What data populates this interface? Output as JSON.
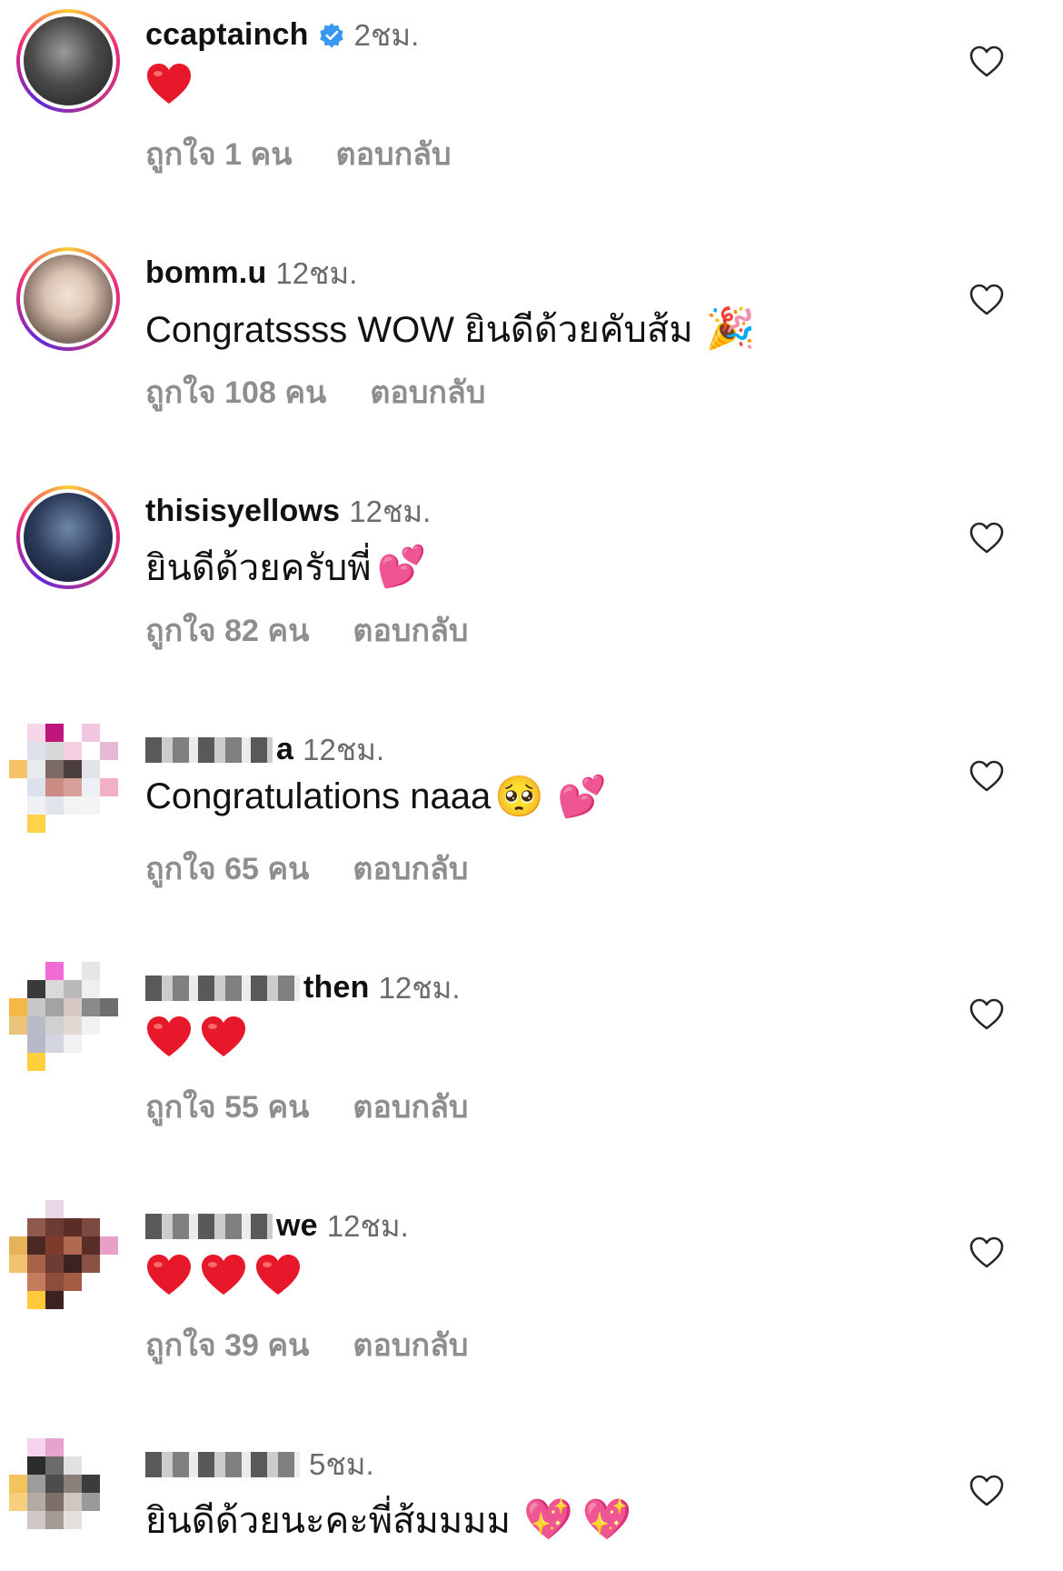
{
  "comments": [
    {
      "username": "ccaptainch",
      "verified": true,
      "time": "2ชม.",
      "text": "",
      "emoji": [
        "red-heart"
      ],
      "likes": "ถูกใจ 1 คน",
      "reply": "ตอบกลับ"
    },
    {
      "username": "bomm.u",
      "verified": false,
      "time": "12ชม.",
      "text": "Congratssss WOW ยินดีด้วยคับส้ม",
      "emoji": [
        "party-popper"
      ],
      "likes": "ถูกใจ 108 คน",
      "reply": "ตอบกลับ"
    },
    {
      "username": "thisisyellows",
      "verified": false,
      "time": "12ชม.",
      "text": "ยินดีด้วยครับพี่",
      "emoji": [
        "two-hearts"
      ],
      "likes": "ถูกใจ 82 คน",
      "reply": "ตอบกลับ"
    },
    {
      "username": "a",
      "verified": false,
      "time": "12ชม.",
      "text": "Congratulations naaa",
      "emoji": [
        "pleading-face",
        "two-hearts"
      ],
      "likes": "ถูกใจ 65 คน",
      "reply": "ตอบกลับ"
    },
    {
      "username": "then",
      "verified": false,
      "time": "12ชม.",
      "text": "",
      "emoji": [
        "red-heart",
        "red-heart"
      ],
      "likes": "ถูกใจ 55 คน",
      "reply": "ตอบกลับ"
    },
    {
      "username": "we",
      "verified": false,
      "time": "12ชม.",
      "text": "",
      "emoji": [
        "red-heart",
        "red-heart",
        "red-heart"
      ],
      "likes": "ถูกใจ 39 คน",
      "reply": "ตอบกลับ"
    },
    {
      "username": "",
      "verified": false,
      "time": "5ชม.",
      "text": "ยินดีด้วยนะคะพี่ส้มมมม",
      "emoji": [
        "sparkling-heart",
        "sparkling-heart"
      ],
      "likes": "",
      "reply": ""
    }
  ],
  "colors": {
    "text": "#111111",
    "muted": "#8e8e8e",
    "verified": "#3897f0",
    "heart": "#ed4956"
  }
}
